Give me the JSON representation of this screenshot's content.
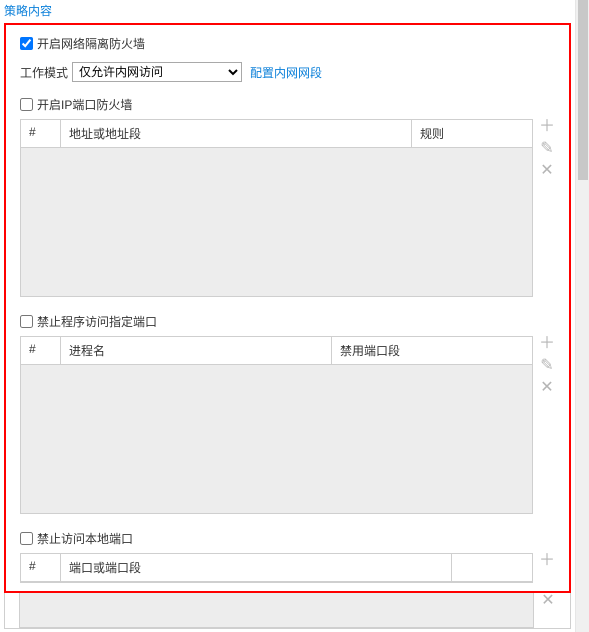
{
  "header": {
    "title": "策略内容"
  },
  "main": {
    "enable_firewall": {
      "checked": true,
      "label": "开启网络隔离防火墙"
    },
    "work_mode": {
      "label": "工作模式",
      "selected": "仅允许内网访问",
      "config_link": "配置内网网段"
    },
    "ip_port_firewall": {
      "checked": false,
      "label": "开启IP端口防火墙",
      "columns": {
        "index": "#",
        "address": "地址或地址段",
        "rule": "规则"
      }
    },
    "program_port": {
      "checked": false,
      "label": "禁止程序访问指定端口",
      "columns": {
        "index": "#",
        "process": "进程名",
        "disabled_port": "禁用端口段"
      }
    },
    "local_port": {
      "checked": false,
      "label": "禁止访问本地端口",
      "columns": {
        "index": "#",
        "port": "端口或端口段"
      }
    }
  },
  "icons": {
    "add": "＋",
    "edit": "✎",
    "delete": "✕"
  }
}
